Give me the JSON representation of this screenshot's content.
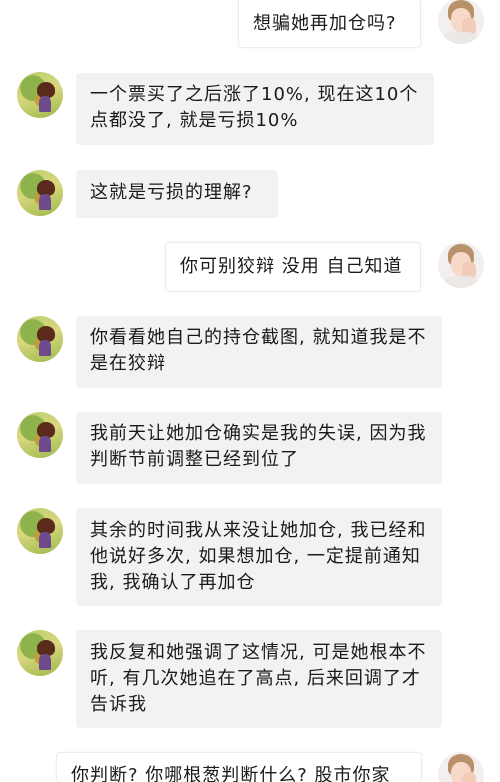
{
  "messages": [
    {
      "side": "right",
      "text": "想骗她再加仓吗?"
    },
    {
      "side": "left",
      "text": "一个票买了之后涨了10%, 现在这10个点都没了, 就是亏损10%"
    },
    {
      "side": "left",
      "text": "这就是亏损的理解?"
    },
    {
      "side": "right",
      "text": "你可别狡辩 没用 自己知道"
    },
    {
      "side": "left",
      "text": "你看看她自己的持仓截图, 就知道我是不是在狡辩"
    },
    {
      "side": "left",
      "text": "我前天让她加仓确实是我的失误, 因为我判断节前调整已经到位了"
    },
    {
      "side": "left",
      "text": "其余的时间我从来没让她加仓, 我已经和他说好多次, 如果想加仓, 一定提前通知我, 我确认了再加仓"
    },
    {
      "side": "left",
      "text": "我反复和她强调了这情况, 可是她根本不听, 有几次她追在了高点, 后来回调了才告诉我"
    },
    {
      "side": "right",
      "text": "你判断? 你哪根葱判断什么? 股市你家"
    }
  ]
}
